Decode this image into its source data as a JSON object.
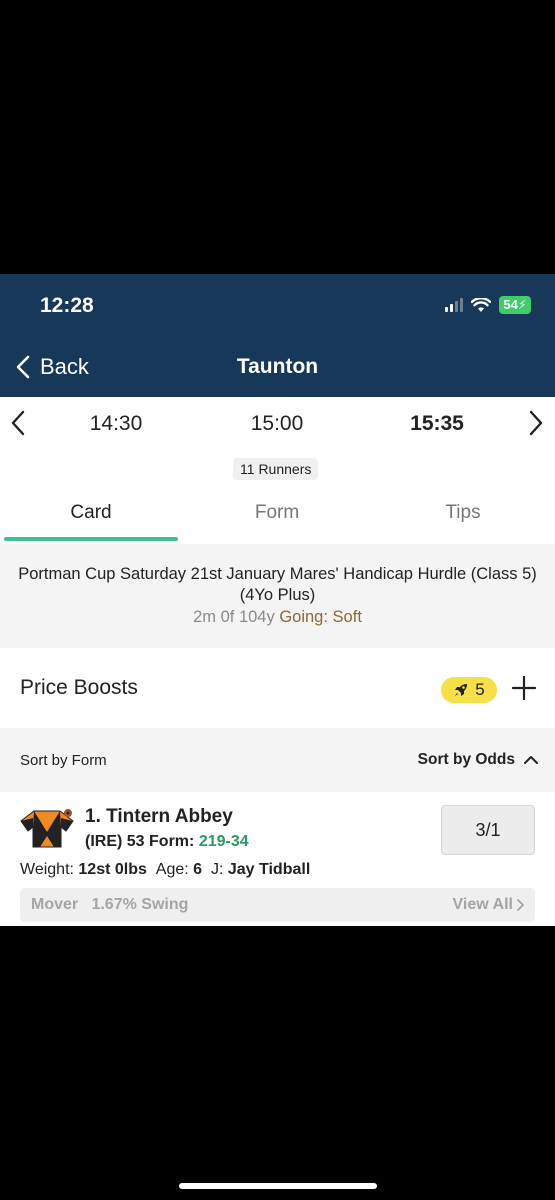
{
  "status_bar": {
    "time": "12:28",
    "battery": "54"
  },
  "nav": {
    "back_label": "Back",
    "title": "Taunton"
  },
  "race_times": [
    {
      "label": "14:30",
      "active": false
    },
    {
      "label": "15:00",
      "active": false
    },
    {
      "label": "15:35",
      "active": true
    }
  ],
  "runners_badge": {
    "count": "11",
    "label": "Runners"
  },
  "tabs": [
    {
      "label": "Card",
      "active": true
    },
    {
      "label": "Form",
      "active": false
    },
    {
      "label": "Tips",
      "active": false
    }
  ],
  "race_info": {
    "title": "Portman Cup Saturday 21st January Mares' Handicap Hurdle (Class 5) (4Yo Plus)",
    "distance": "2m 0f 104y",
    "going_label": "Going:",
    "going_value": "Soft"
  },
  "price_boosts": {
    "label": "Price Boosts",
    "count": "5"
  },
  "sort": {
    "form_label": "Sort by Form",
    "odds_label": "Sort by Odds"
  },
  "runners": [
    {
      "number_name": "1. Tintern Abbey",
      "origin_rating": "(IRE) 53",
      "form_label": "Form:",
      "form_value": "219-34",
      "weight_label": "Weight:",
      "weight_value": "12st 0lbs",
      "age_label": "Age:",
      "age_value": "6",
      "jockey_label": "J:",
      "jockey_value": "Jay Tidball",
      "odds": "3/1",
      "mover_text": "Mover   1.67% Swing",
      "view_all_label": "View All"
    }
  ],
  "colors": {
    "header_bg": "#173859",
    "tab_indicator": "#3ec28f",
    "form_green": "#2b9a63",
    "going_brown": "#8a6a38",
    "boost_yellow": "#f6e049",
    "silks_orange": "#f08a24"
  },
  "icons": {
    "back": "chevron-left-icon",
    "prev_race": "chevron-left-icon",
    "next_race": "chevron-right-icon",
    "boost": "rocket-icon",
    "add": "plus-icon",
    "sort_odds": "chevron-up-icon",
    "view_all": "chevron-right-icon"
  }
}
